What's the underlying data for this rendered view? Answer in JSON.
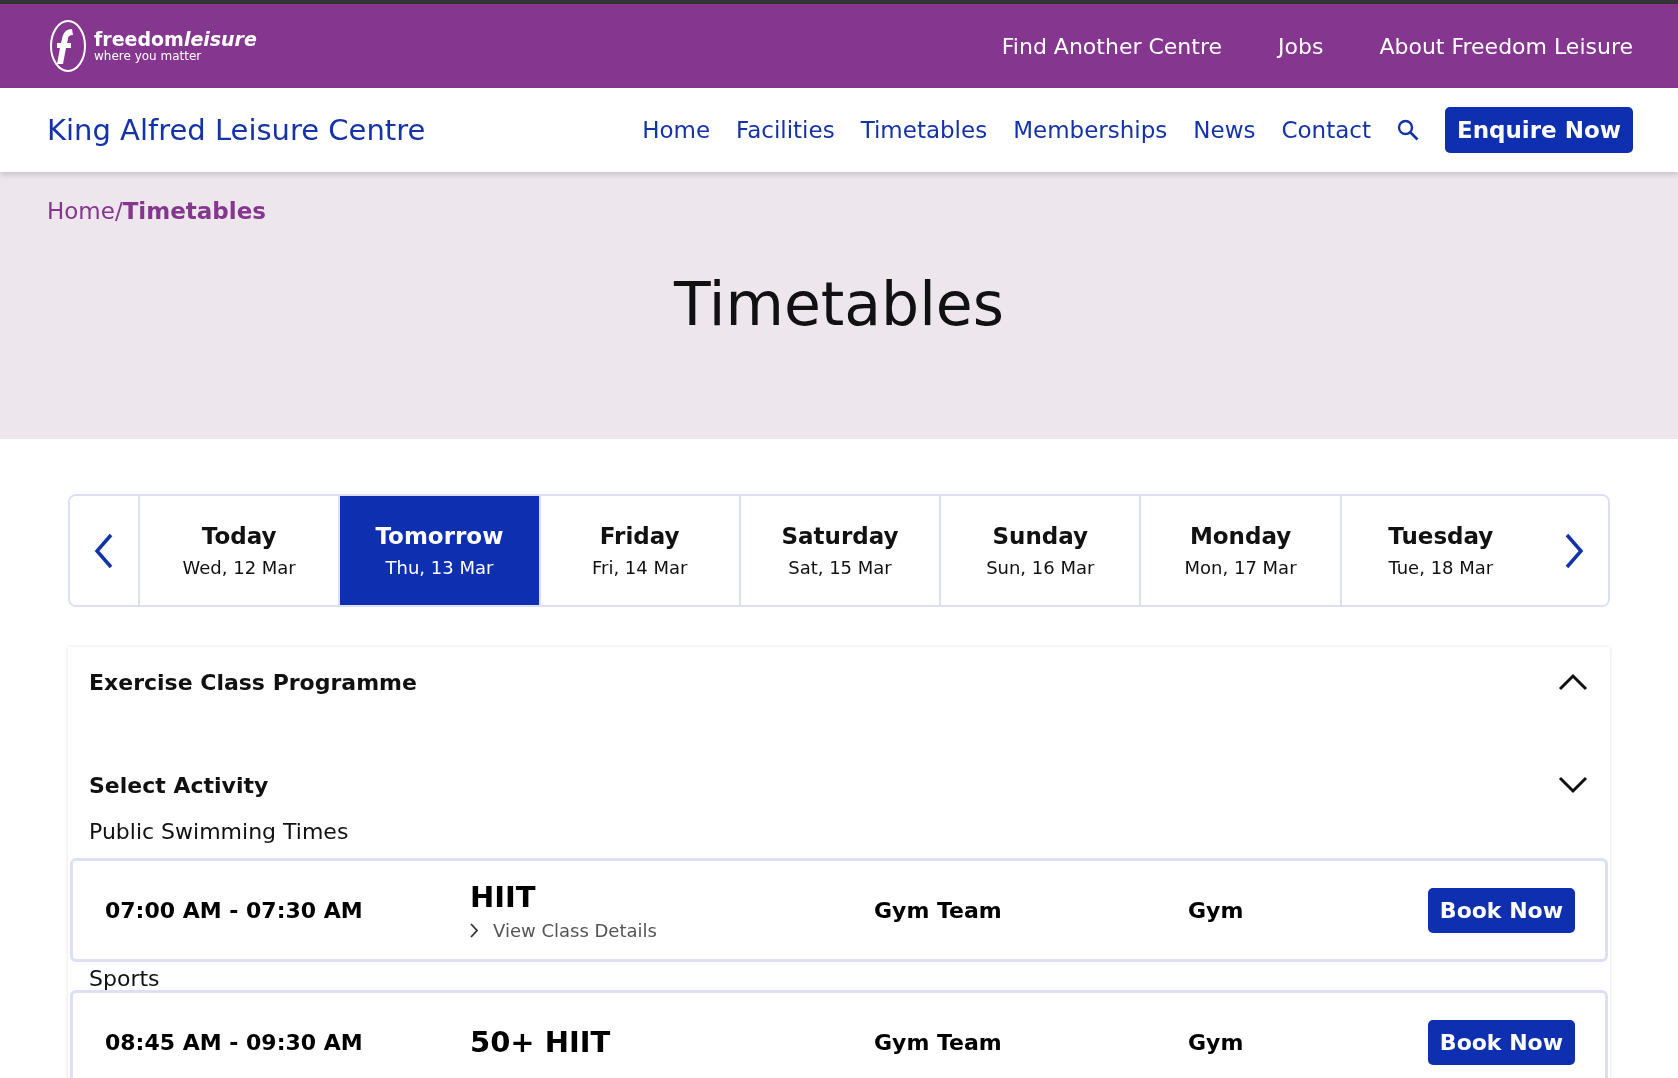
{
  "brand": {
    "name": "freedom",
    "name_italic": "leisure",
    "tagline": "where you matter"
  },
  "top_links": [
    "Find Another Centre",
    "Jobs",
    "About Freedom Leisure"
  ],
  "centre_name": "King Alfred Leisure Centre",
  "nav": [
    "Home",
    "Facilities",
    "Timetables",
    "Memberships",
    "News",
    "Contact"
  ],
  "enquire_button": "Enquire Now",
  "breadcrumb": [
    {
      "label": "Home",
      "current": false
    },
    {
      "label": "Timetables",
      "current": true
    }
  ],
  "breadcrumb_separator": "/",
  "page_title": "Timetables",
  "days": [
    {
      "label": "Today",
      "date": "Wed, 12 Mar",
      "selected": false
    },
    {
      "label": "Tomorrow",
      "date": "Thu, 13 Mar",
      "selected": true
    },
    {
      "label": "Friday",
      "date": "Fri, 14 Mar",
      "selected": false
    },
    {
      "label": "Saturday",
      "date": "Sat, 15 Mar",
      "selected": false
    },
    {
      "label": "Sunday",
      "date": "Sun, 16 Mar",
      "selected": false
    },
    {
      "label": "Monday",
      "date": "Mon, 17 Mar",
      "selected": false
    },
    {
      "label": "Tuesday",
      "date": "Tue, 18 Mar",
      "selected": false
    }
  ],
  "programme": {
    "title": "Exercise Class Programme",
    "expanded": true,
    "filter_label": "Select Activity",
    "sections": [
      {
        "heading": "Public Swimming Times",
        "classes": [
          {
            "time": "07:00 AM - 07:30 AM",
            "name": "HIIT",
            "details_link": "View Class Details",
            "coach": "Gym Team",
            "location": "Gym",
            "button": "Book Now"
          }
        ]
      },
      {
        "heading": "Sports",
        "classes": [
          {
            "time": "08:45 AM - 09:30 AM",
            "name": "50+ HIIT",
            "coach": "Gym Team",
            "location": "Gym",
            "button": "Book Now"
          }
        ]
      }
    ]
  }
}
